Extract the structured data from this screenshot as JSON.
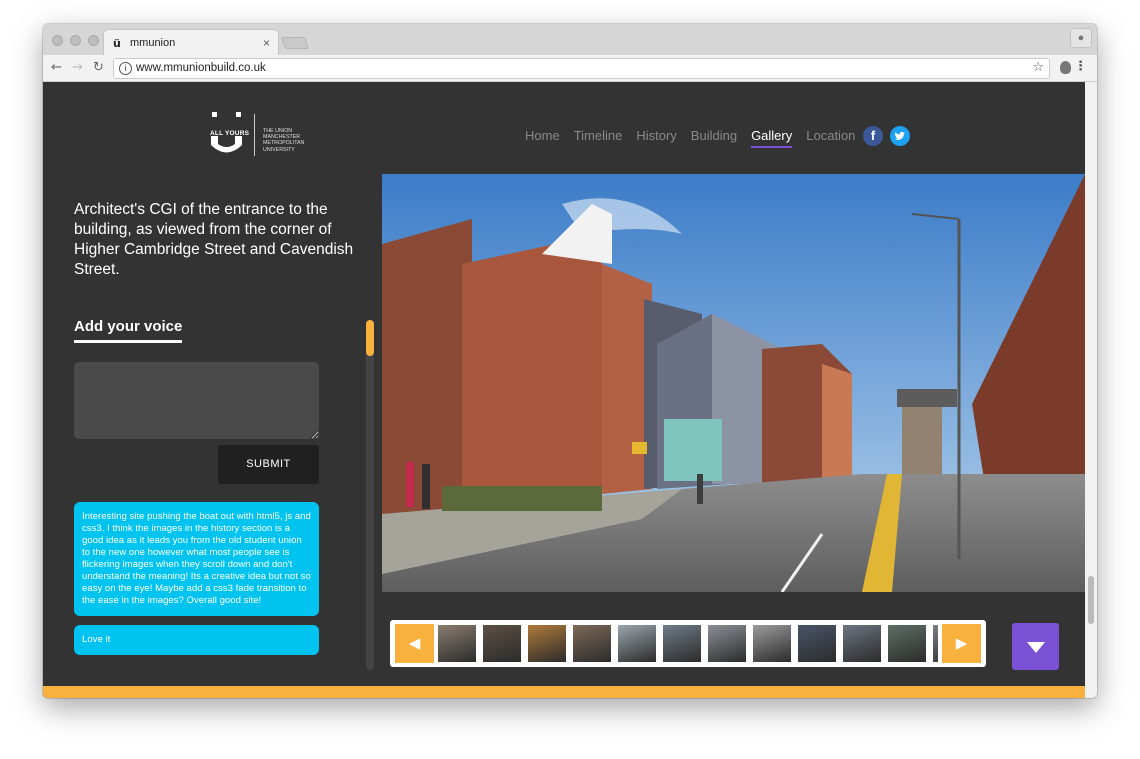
{
  "browser": {
    "tab_title": "mmunion",
    "tab_favicon": "ü",
    "tab_close": "×",
    "url": "www.mmunionbuild.co.uk",
    "back_icon": "arrow-left",
    "forward_icon": "arrow-right",
    "reload_icon": "reload",
    "star_icon": "star",
    "menu_icon": "kebab"
  },
  "site": {
    "logo": {
      "tagline": "ALL YOURS",
      "org": "THE UNION MANCHESTER METROPOLITAN UNIVERSITY"
    },
    "nav": [
      {
        "label": "Home",
        "active": false
      },
      {
        "label": "Timeline",
        "active": false
      },
      {
        "label": "History",
        "active": false
      },
      {
        "label": "Building",
        "active": false
      },
      {
        "label": "Gallery",
        "active": true
      },
      {
        "label": "Location",
        "active": false
      }
    ],
    "social": {
      "facebook": "f",
      "twitter": "t"
    },
    "caption": "Architect's CGI of the entrance to the building, as viewed from the corner of Higher Cambridge Street and Cavendish Street.",
    "voice_heading": "Add your voice",
    "voice_input_value": "",
    "submit_label": "SUBMIT",
    "comments": [
      "Interesting site pushing the boat out with html5, js and css3. I think the images in the history section is a good idea as it leads you from the old student union to the new one however what most people see is flickering images when they scroll down and don't understand the meaning! Its a creative idea but not so easy on the eye! Maybe add a css3 fade transition to the ease in the images? Overall good site!",
      "Love it"
    ],
    "colors": {
      "accent_orange": "#f7b13c",
      "accent_purple": "#7b52d6",
      "comment_blue": "#00c4ef",
      "page_bg": "#333333"
    },
    "gallery": {
      "prev_icon": "◀",
      "next_icon": "▶",
      "thumbnails": [
        {
          "tone": "#8a7d6f"
        },
        {
          "tone": "#5c5044"
        },
        {
          "tone": "#b07a3a"
        },
        {
          "tone": "#7e6a58"
        },
        {
          "tone": "#9aa6ad"
        },
        {
          "tone": "#6f7c87"
        },
        {
          "tone": "#8b9096"
        },
        {
          "tone": "#9c9c9c"
        },
        {
          "tone": "#4a5568"
        },
        {
          "tone": "#6b7580"
        },
        {
          "tone": "#5e6f64"
        },
        {
          "tone": "#7a7f86"
        }
      ]
    }
  }
}
